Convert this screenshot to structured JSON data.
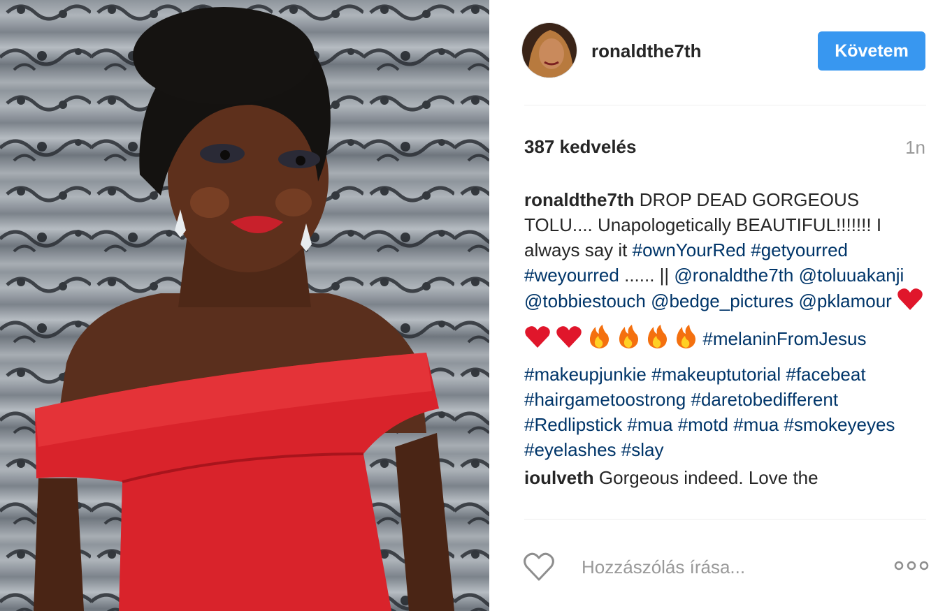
{
  "photo": {
    "alt_icon": "portrait-photo",
    "dress_color": "#d9232b"
  },
  "header": {
    "username": "ronaldthe7th",
    "follow_label": "Követem",
    "follow_color": "#3897f0"
  },
  "stats": {
    "likes": "387 kedvelés",
    "time": "1n"
  },
  "caption": {
    "user": "ronaldthe7th",
    "text1": "DROP DEAD GORGEOUS TOLU.... Unapologetically BEAUTIFUL!!!!!!! I always say it",
    "tags1": [
      "#ownYourRed",
      "#getyourred",
      "#weyourred"
    ],
    "sep": "...... ||",
    "mentions": [
      "@ronaldthe7th",
      "@toluuakanji",
      "@tobbiestouch",
      "@bedge_pictures",
      "@pklamour"
    ],
    "emojis": [
      "heart",
      "heart",
      "heart",
      "fire",
      "fire",
      "fire",
      "fire"
    ],
    "tags2": [
      "#melaninFromJesus",
      "#makeupjunkie",
      "#makeuptutorial",
      "#facebeat",
      "#hairgametoostrong",
      "#daretobedifferent",
      "#Redlipstick",
      "#mua",
      "#motd",
      "#mua",
      "#smokeyeyes",
      "#eyelashes",
      "#slay"
    ]
  },
  "comment2": {
    "user": "ioulveth",
    "text": "Gorgeous indeed. Love the"
  },
  "actions": {
    "placeholder": "Hozzászólás írása...",
    "heart_icon": "heart-outline-icon",
    "more_icon": "more-dots-icon"
  }
}
